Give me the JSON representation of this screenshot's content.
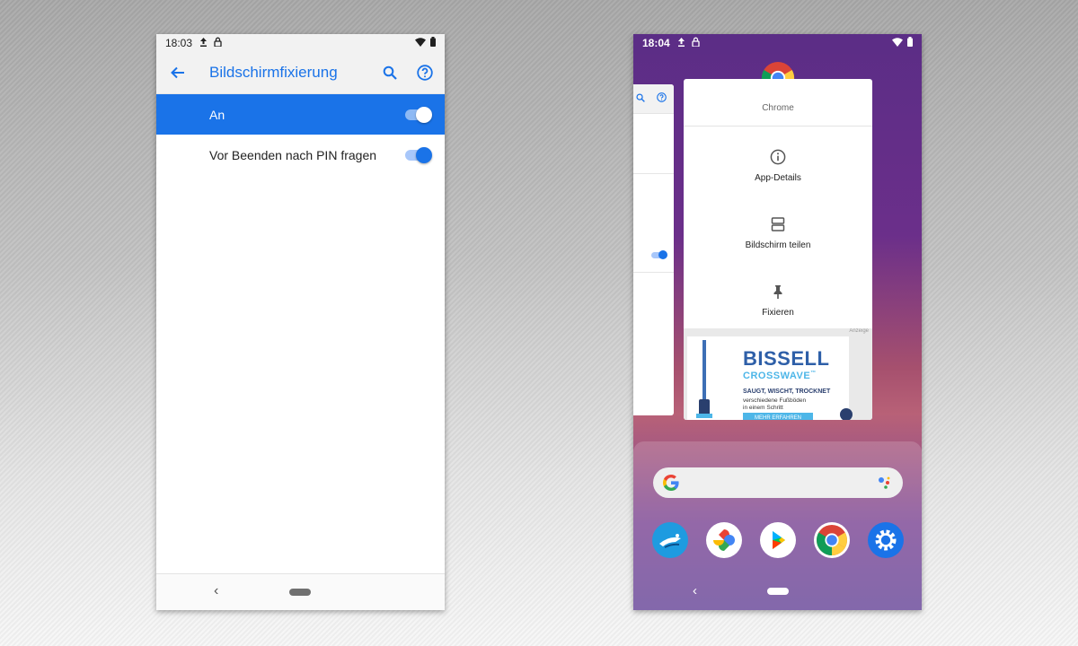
{
  "left_phone": {
    "status_bar": {
      "time": "18:03"
    },
    "app_bar": {
      "title": "Bildschirmfixierung"
    },
    "settings": [
      {
        "label": "An",
        "enabled": true
      },
      {
        "label": "Vor Beenden nach PIN fragen",
        "enabled": true
      }
    ],
    "nav_bar": {
      "back_glyph": "‹"
    }
  },
  "right_phone": {
    "status_bar": {
      "time": "18:04"
    },
    "recent_app": {
      "name": "Chrome",
      "menu": [
        {
          "label": "App-Details",
          "icon": "info-icon"
        },
        {
          "label": "Bildschirm teilen",
          "icon": "split-screen-icon"
        },
        {
          "label": "Fixieren",
          "icon": "pin-icon"
        }
      ],
      "ad": {
        "badge": "Anzeige",
        "brand": "BISSELL",
        "product": "CROSSWAVE",
        "product_tm": "™",
        "tagline": "SAUGT, WISCHT, TROCKNET",
        "subline1": "verschiedene Fußböden",
        "subline2": "in einem Schritt",
        "cta": "MEHR ERFAHREN"
      }
    },
    "dock": {
      "apps": [
        {
          "icon": "copilot-icon",
          "color": "#1e9be0"
        },
        {
          "icon": "photos-icon",
          "color": "#ffffff"
        },
        {
          "icon": "play-store-icon",
          "color": "#ffffff"
        },
        {
          "icon": "chrome-icon",
          "color": "#ffffff"
        },
        {
          "icon": "settings-icon",
          "color": "#1a73e8"
        }
      ]
    },
    "nav_bar": {
      "back_glyph": "‹"
    }
  },
  "colors": {
    "accent": "#1a73e8",
    "wallpaper_top": "#5b2d86",
    "wallpaper_mid": "#b86177"
  }
}
